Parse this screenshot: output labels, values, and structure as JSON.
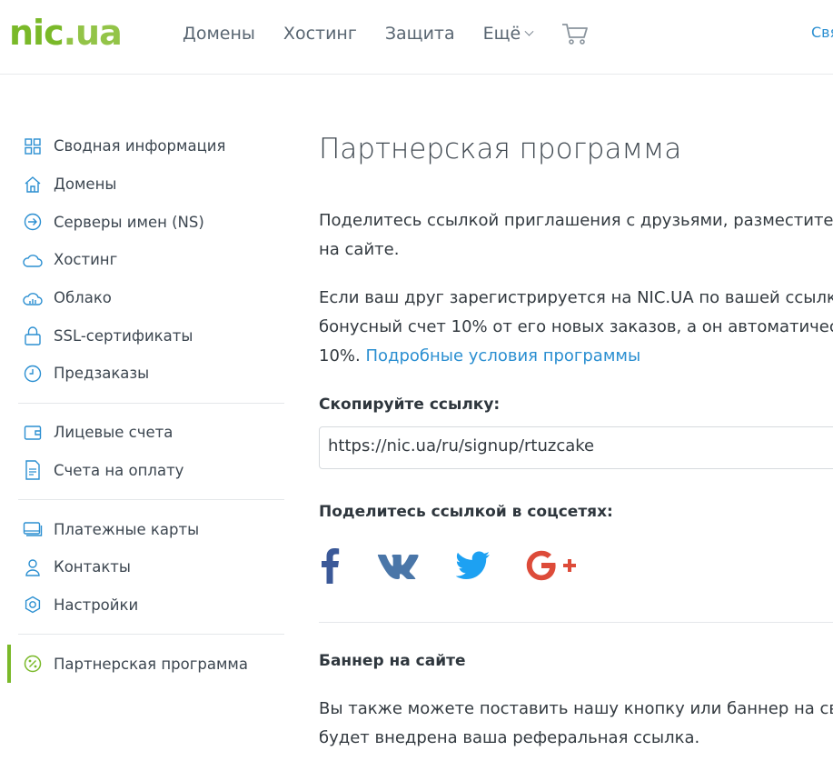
{
  "header": {
    "logo": {
      "part1": "nic",
      "part2": ".",
      "part3": "ua"
    },
    "nav": [
      {
        "label": "Домены"
      },
      {
        "label": "Хостинг"
      },
      {
        "label": "Защита"
      },
      {
        "label": "Ещё"
      }
    ],
    "contact_label": "Свя"
  },
  "sidebar": {
    "groups": [
      [
        {
          "label": "Сводная информация",
          "icon": "grid-icon"
        },
        {
          "label": "Домены",
          "icon": "house-icon"
        },
        {
          "label": "Серверы имен (NS)",
          "icon": "arrow-circle-icon"
        },
        {
          "label": "Хостинг",
          "icon": "cloud-icon"
        },
        {
          "label": "Облако",
          "icon": "cloud-chart-icon"
        },
        {
          "label": "SSL-сертификаты",
          "icon": "lock-icon"
        },
        {
          "label": "Предзаказы",
          "icon": "clock-icon"
        }
      ],
      [
        {
          "label": "Лицевые счета",
          "icon": "wallet-icon"
        },
        {
          "label": "Счета на оплату",
          "icon": "document-icon"
        }
      ],
      [
        {
          "label": "Платежные карты",
          "icon": "card-icon"
        },
        {
          "label": "Контакты",
          "icon": "user-icon"
        },
        {
          "label": "Настройки",
          "icon": "gear-icon"
        }
      ],
      [
        {
          "label": "Партнерская программа",
          "icon": "percent-icon",
          "active": true
        }
      ]
    ]
  },
  "main": {
    "title": "Партнерская программа",
    "intro_line1": "Поделитесь ссылкой приглашения с друзьями, разместите",
    "intro_line2": "на сайте.",
    "bonus_line1": "Если ваш друг зарегистрируется на NIC.UA по вашей ссылк",
    "bonus_line2": "бонусный счет 10% от его новых заказов, а он автоматичес",
    "bonus_line3_prefix": "10%.",
    "bonus_link": "Подробные условия программы",
    "copy_label": "Скопируйте ссылку:",
    "referral_url": "https://nic.ua/ru/signup/rtuzcake",
    "share_label": "Поделитесь ссылкой в соцсетях:",
    "socials": [
      {
        "name": "facebook",
        "icon": "facebook-icon",
        "color": "#3b5998"
      },
      {
        "name": "vk",
        "icon": "vk-icon",
        "color": "#4a76a8"
      },
      {
        "name": "twitter",
        "icon": "twitter-icon",
        "color": "#1da1f2"
      },
      {
        "name": "google-plus",
        "icon": "google-plus-icon",
        "color": "#dd4b39"
      }
    ],
    "banner_title": "Баннер на сайте",
    "banner_line1": "Вы также можете поставить нашу кнопку или баннер на св",
    "banner_line2": "будет внедрена ваша реферальная ссылка."
  },
  "colors": {
    "brand_green": "#7ab929",
    "link_blue": "#2b8fd1",
    "text": "#333a40"
  }
}
